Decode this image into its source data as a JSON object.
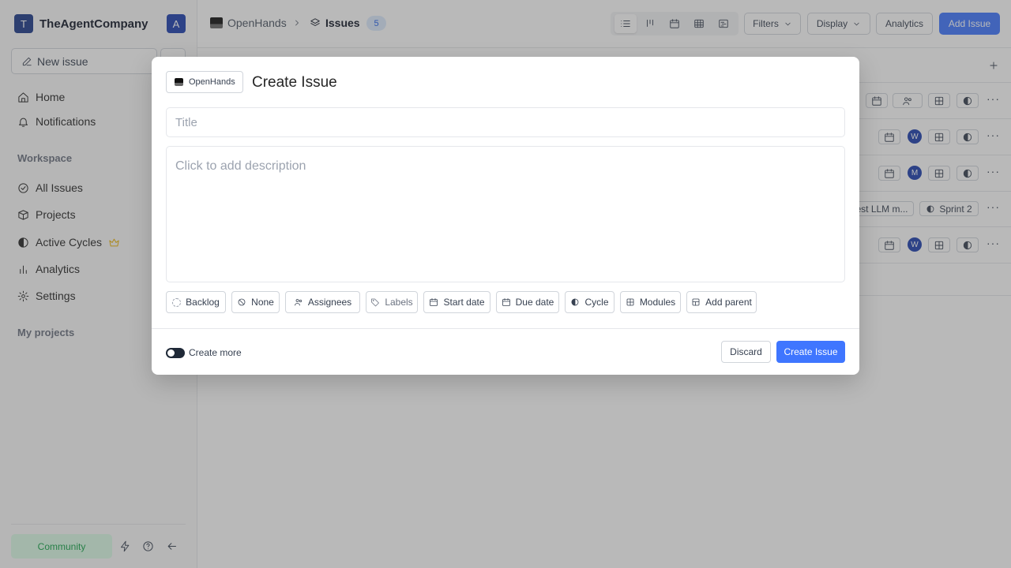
{
  "colors": {
    "accent": "#3f76ff",
    "community_bg": "#dcfce7",
    "community_text": "#16a34a",
    "badge_bg": "#dbeafe"
  },
  "sidebar": {
    "workspace_initial": "T",
    "workspace_name": "TheAgentCompany",
    "user_initial": "A",
    "new_issue_label": "New issue",
    "top_items": [
      {
        "label": "Home",
        "icon": "home-icon"
      },
      {
        "label": "Notifications",
        "icon": "bell-icon"
      }
    ],
    "workspace_label": "Workspace",
    "workspace_items": [
      {
        "label": "All Issues",
        "icon": "check-circle-icon"
      },
      {
        "label": "Projects",
        "icon": "box-icon"
      },
      {
        "label": "Active Cycles",
        "icon": "contrast-icon",
        "badge_icon": "crown-icon"
      },
      {
        "label": "Analytics",
        "icon": "bar-chart-icon"
      },
      {
        "label": "Settings",
        "icon": "gear-icon"
      }
    ],
    "my_projects_label": "My projects",
    "community_label": "Community"
  },
  "header": {
    "project_name": "OpenHands",
    "page_name": "Issues",
    "issue_count": "5",
    "filters_label": "Filters",
    "display_label": "Display",
    "analytics_label": "Analytics",
    "add_issue_label": "Add Issue"
  },
  "list": {
    "rows": [
      {
        "avatar": ""
      },
      {
        "avatar": "W"
      },
      {
        "avatar": "M"
      },
      {
        "module_text": "est LLM m...",
        "cycle_text": "Sprint 2"
      },
      {
        "avatar": "W"
      }
    ]
  },
  "modal": {
    "project_label": "OpenHands",
    "title": "Create Issue",
    "title_placeholder": "Title",
    "description_placeholder": "Click to add description",
    "chips": {
      "state": "Backlog",
      "priority": "None",
      "assignees": "Assignees",
      "labels": "Labels",
      "start_date": "Start date",
      "due_date": "Due date",
      "cycle": "Cycle",
      "modules": "Modules",
      "parent": "Add parent"
    },
    "create_more_label": "Create more",
    "discard_label": "Discard",
    "create_label": "Create Issue"
  }
}
